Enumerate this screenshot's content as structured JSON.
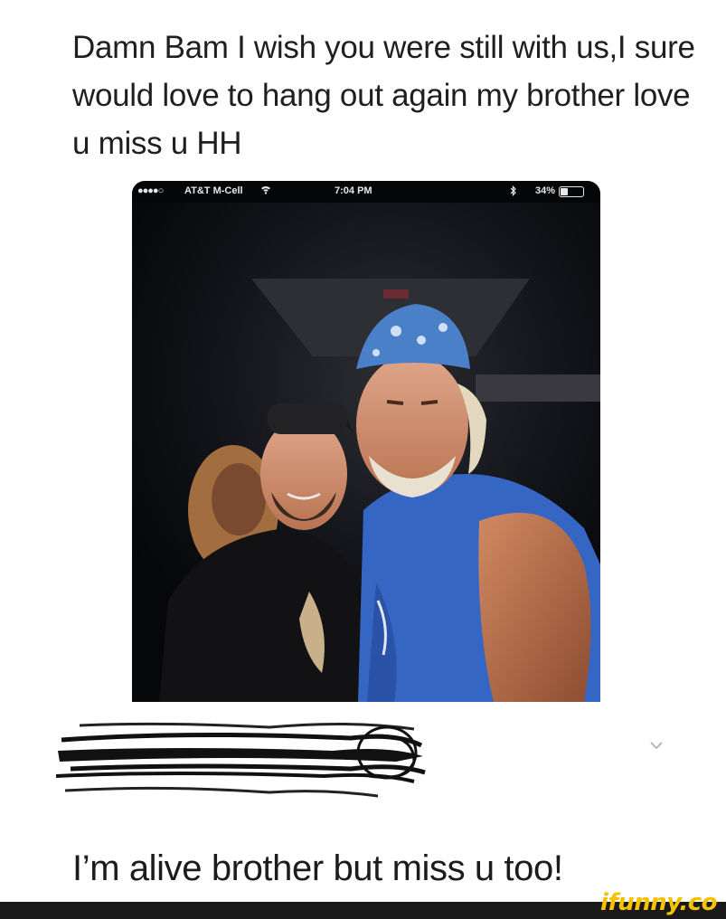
{
  "post": {
    "text": "Damn  Bam I wish you were still with us,I sure would love to hang out again my brother love u miss u HH"
  },
  "phone_status_bar": {
    "signal": "●●●●○",
    "carrier": "AT&T M-Cell",
    "wifi_icon": "wifi-icon",
    "time": "7:04 PM",
    "bluetooth_icon": "bluetooth-icon",
    "battery_percent": "34%",
    "battery_level": 0.34
  },
  "photo": {
    "description_icon": "photo-of-two-men"
  },
  "comment": {
    "redacted": true,
    "chevron_icon": "chevron-down-icon",
    "reply_text": "I’m alive brother but miss u too!"
  },
  "watermark": {
    "text": "ifunny.co",
    "color": "#f6c200"
  },
  "colors": {
    "background": "#ffffff",
    "text": "#1f1f1f",
    "screenshot_bg": "#050608",
    "bandana_blue": "#4a80c8",
    "shirt_blue": "#3566c4"
  }
}
